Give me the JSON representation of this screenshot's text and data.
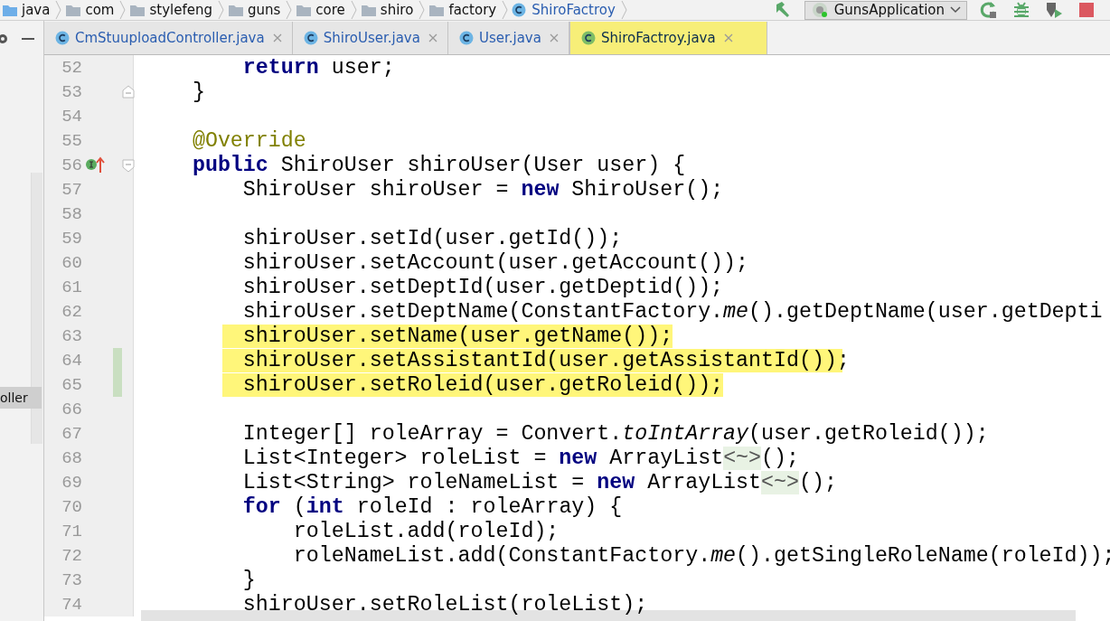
{
  "breadcrumbs": [
    {
      "kind": "folder",
      "label": "java"
    },
    {
      "kind": "folder",
      "label": "com"
    },
    {
      "kind": "folder",
      "label": "stylefeng"
    },
    {
      "kind": "folder",
      "label": "guns"
    },
    {
      "kind": "folder",
      "label": "core"
    },
    {
      "kind": "folder",
      "label": "shiro"
    },
    {
      "kind": "folder",
      "label": "factory"
    },
    {
      "kind": "class",
      "label": "ShiroFactroy"
    }
  ],
  "run_config": {
    "label": "GunsApplication"
  },
  "side_panel": {
    "label": "oller"
  },
  "tabs": [
    {
      "label": "CmStuuploadController.java",
      "selected": false,
      "highlighted": false
    },
    {
      "label": "ShiroUser.java",
      "selected": false,
      "highlighted": false
    },
    {
      "label": "User.java",
      "selected": false,
      "highlighted": false
    },
    {
      "label": "ShiroFactroy.java",
      "selected": true,
      "highlighted": true
    }
  ],
  "code_lines": [
    {
      "number": "52",
      "tokens": [
        {
          "kind": "keyword",
          "text": "        return"
        },
        {
          "kind": "plain",
          "text": " user;"
        }
      ]
    },
    {
      "number": "53",
      "fold_end": true,
      "tokens": [
        {
          "kind": "plain",
          "text": "    }"
        }
      ]
    },
    {
      "number": "54"
    },
    {
      "number": "55",
      "tokens": [
        {
          "kind": "annotation",
          "text": "    @Override"
        }
      ]
    },
    {
      "number": "56",
      "fold_start": true,
      "implements": true,
      "tokens": [
        {
          "kind": "keyword",
          "text": "    public"
        },
        {
          "kind": "plain",
          "text": " ShiroUser shiroUser(User user) {"
        }
      ]
    },
    {
      "number": "57",
      "tokens": [
        {
          "kind": "plain",
          "text": "        ShiroUser shiroUser = "
        },
        {
          "kind": "keyword",
          "text": "new"
        },
        {
          "kind": "plain",
          "text": " ShiroUser();"
        }
      ]
    },
    {
      "number": "58"
    },
    {
      "number": "59",
      "tokens": [
        {
          "kind": "plain",
          "text": "        shiroUser.setId(user.getId());"
        }
      ]
    },
    {
      "number": "60",
      "tokens": [
        {
          "kind": "plain",
          "text": "        shiroUser.setAccount(user.getAccount());"
        }
      ]
    },
    {
      "number": "61",
      "tokens": [
        {
          "kind": "plain",
          "text": "        shiroUser.setDeptId(user.getDeptid());"
        }
      ]
    },
    {
      "number": "62",
      "tokens": [
        {
          "kind": "plain",
          "text": "        shiroUser.setDeptName(ConstantFactory."
        },
        {
          "kind": "italic",
          "text": "me"
        },
        {
          "kind": "plain",
          "text": "().getDeptName(user.getDepti"
        }
      ]
    },
    {
      "number": "63",
      "highlighted": true,
      "tokens": [
        {
          "kind": "plain",
          "text": "        shiroUser.setName(user.getName());"
        }
      ]
    },
    {
      "number": "64",
      "highlighted": true,
      "changed": true,
      "tokens": [
        {
          "kind": "plain",
          "text": "        shiroUser.setAssistantId(user.getAssistantId());"
        }
      ]
    },
    {
      "number": "65",
      "highlighted": true,
      "changed": true,
      "tokens": [
        {
          "kind": "plain",
          "text": "        shiroUser.setRoleid(user.getRoleid());"
        }
      ]
    },
    {
      "number": "66"
    },
    {
      "number": "67",
      "tokens": [
        {
          "kind": "plain",
          "text": "        Integer[] roleArray = Convert."
        },
        {
          "kind": "italic",
          "text": "toIntArray"
        },
        {
          "kind": "plain",
          "text": "(user.getRoleid());"
        }
      ]
    },
    {
      "number": "68",
      "tokens": [
        {
          "kind": "plain",
          "text": "        List<Integer> roleList = "
        },
        {
          "kind": "keyword",
          "text": "new"
        },
        {
          "kind": "plain",
          "text": " ArrayList"
        },
        {
          "kind": "hint",
          "text": "<~>"
        },
        {
          "kind": "plain",
          "text": "();"
        }
      ]
    },
    {
      "number": "69",
      "tokens": [
        {
          "kind": "plain",
          "text": "        List<String> roleNameList = "
        },
        {
          "kind": "keyword",
          "text": "new"
        },
        {
          "kind": "plain",
          "text": " ArrayList"
        },
        {
          "kind": "hint",
          "text": "<~>"
        },
        {
          "kind": "plain",
          "text": "();"
        }
      ]
    },
    {
      "number": "70",
      "tokens": [
        {
          "kind": "keyword",
          "text": "        for"
        },
        {
          "kind": "plain",
          "text": " ("
        },
        {
          "kind": "keyword",
          "text": "int"
        },
        {
          "kind": "plain",
          "text": " roleId : roleArray) {"
        }
      ]
    },
    {
      "number": "71",
      "tokens": [
        {
          "kind": "plain",
          "text": "            roleList.add(roleId);"
        }
      ]
    },
    {
      "number": "72",
      "tokens": [
        {
          "kind": "plain",
          "text": "            roleNameList.add(ConstantFactory."
        },
        {
          "kind": "italic",
          "text": "me"
        },
        {
          "kind": "plain",
          "text": "().getSingleRoleName(roleId));"
        }
      ]
    },
    {
      "number": "73",
      "tokens": [
        {
          "kind": "plain",
          "text": "        }"
        }
      ]
    },
    {
      "number": "74",
      "tokens": [
        {
          "kind": "plain",
          "text": "        shiroUser.setRoleList(roleList);"
        }
      ]
    }
  ]
}
